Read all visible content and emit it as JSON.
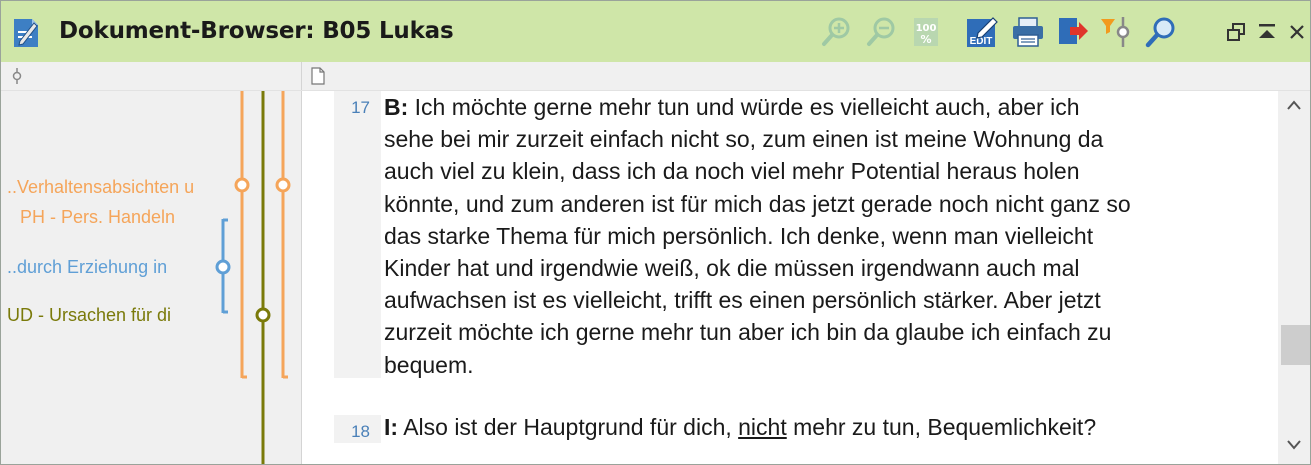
{
  "window": {
    "title": "Dokument-Browser: B05 Lukas"
  },
  "toolbar": {
    "zoom_100_label": "100 %",
    "edit_label": "EDIT"
  },
  "code_pane": {
    "codes": [
      {
        "label": "..Verhaltensabsichten u",
        "color": "#f5a55a"
      },
      {
        "label": "PH - Pers. Handeln",
        "color": "#f5a55a"
      },
      {
        "label": "..durch Erziehung in",
        "color": "#5f9fd6"
      },
      {
        "label": "UD - Ursachen für di",
        "color": "#7a7a0a"
      }
    ]
  },
  "document": {
    "paragraphs": [
      {
        "line_number": "17",
        "speaker": "B:",
        "lines": [
          "Ich möchte gerne mehr tun und würde es vielleicht auch, aber ich",
          "sehe bei mir zurzeit einfach nicht so, zum einen ist meine Wohnung da",
          "auch viel zu klein, dass ich da noch viel mehr Potential heraus holen",
          "könnte, und zum anderen ist für mich das jetzt gerade noch nicht ganz so",
          "das starke Thema für mich persönlich. Ich denke, wenn man vielleicht",
          "Kinder hat und irgendwie weiß, ok die müssen irgendwann auch mal",
          "aufwachsen ist es vielleicht, trifft es einen persönlich stärker. Aber jetzt",
          "zurzeit möchte ich gerne mehr tun aber ich bin da glaube ich einfach zu",
          "bequem."
        ]
      },
      {
        "line_number": "18",
        "speaker": "I:",
        "text_before": "Also ist der Hauptgrund für dich, ",
        "underlined": "nicht",
        "text_after": " mehr zu tun, Bequemlichkeit?"
      }
    ]
  }
}
